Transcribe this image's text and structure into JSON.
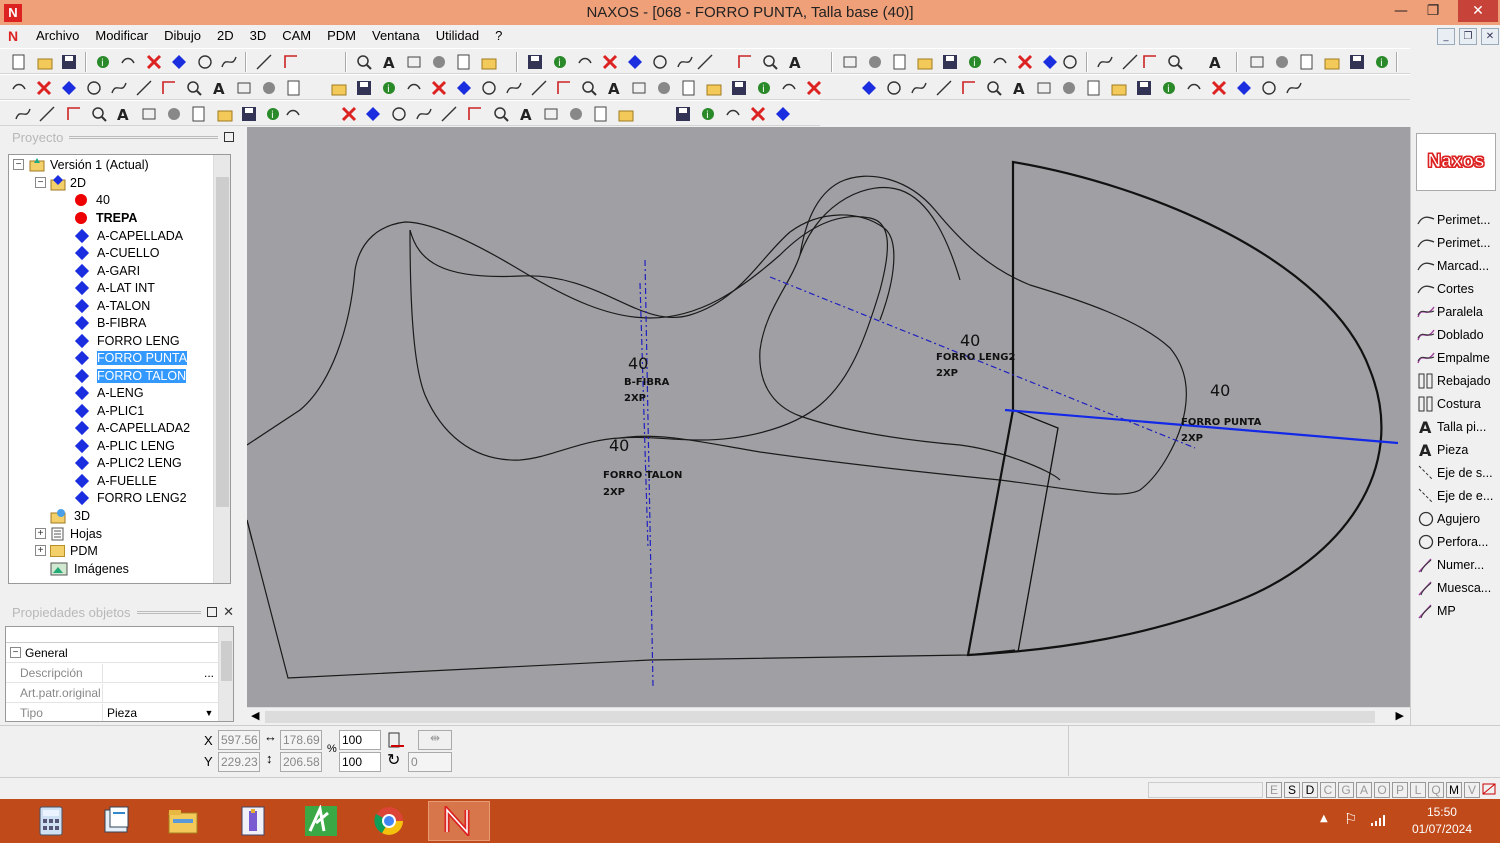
{
  "window": {
    "title": "NAXOS - [068 - FORRO PUNTA, Talla base (40)]",
    "minimize": "—",
    "maximize": "❐",
    "close": "✕"
  },
  "menu": [
    "Archivo",
    "Modificar",
    "Dibujo",
    "2D",
    "3D",
    "CAM",
    "PDM",
    "Ventana",
    "Utilidad",
    "?"
  ],
  "project_panel": {
    "title": "Proyecto",
    "tree": {
      "version": "Versión 1 (Actual)",
      "node_2d": "2D",
      "size": "40",
      "trepa": "TREPA",
      "pieces": [
        "A-CAPELLADA",
        "A-CUELLO",
        "A-GARI",
        "A-LAT INT",
        "A-TALON",
        "B-FIBRA",
        "FORRO LENG",
        "FORRO PUNTA",
        "FORRO TALON",
        "A-LENG",
        "A-PLIC1",
        "A-CAPELLADA2",
        "A-PLIC LENG",
        "A-PLIC2 LENG",
        "A-FUELLE",
        "FORRO LENG2"
      ],
      "node_3d": "3D",
      "hojas": "Hojas",
      "pdm": "PDM",
      "imagenes": "Imágenes"
    }
  },
  "properties_panel": {
    "title": "Propiedades objetos",
    "group": "General",
    "rows": [
      {
        "name": "Descripción",
        "value": "",
        "button": "..."
      },
      {
        "name": "Art.patr.original",
        "value": ""
      },
      {
        "name": "Tipo",
        "value": "Pieza"
      }
    ]
  },
  "canvas_labels": {
    "bfibra": {
      "size": "40",
      "name": "B-FIBRA",
      "qty": "2XP"
    },
    "forro_talon": {
      "size": "40",
      "name": "FORRO TALON",
      "qty": "2XP"
    },
    "forro_leng2": {
      "size": "40",
      "name": "FORRO LENG2",
      "qty": "2XP"
    },
    "forro_punta": {
      "size": "40",
      "name": "FORRO PUNTA",
      "qty": "2XP"
    }
  },
  "right_tools": {
    "logo": "Naxos",
    "items": [
      "Perimet...",
      "Perimet...",
      "Marcad...",
      "Cortes",
      "Paralela",
      "Doblado",
      "Empalme",
      "Rebajado",
      "Costura",
      "Talla pi...",
      "Pieza",
      "Eje de s...",
      "Eje de e...",
      "Agujero",
      "Perfora...",
      "Numer...",
      "Muesca...",
      "MP"
    ]
  },
  "status": {
    "x_label": "X",
    "y_label": "Y",
    "x": "597.56",
    "y": "229.23",
    "width": "178.69",
    "height": "206.58",
    "scale_x": "100",
    "scale_y": "100",
    "percent": "%",
    "rotation": "0"
  },
  "mode_letters": [
    "E",
    "S",
    "D",
    "C",
    "G",
    "A",
    "O",
    "P",
    "L",
    "Q",
    "M",
    "V"
  ],
  "clock": {
    "time": "15:50",
    "date": "01/07/2024"
  },
  "colors": {
    "titlebar": "#f0a079",
    "canvas": "#a0a0a4",
    "taskbar": "#c04a1a",
    "selection": "#3399ff",
    "piece_diamond": "#1a2ee0"
  }
}
